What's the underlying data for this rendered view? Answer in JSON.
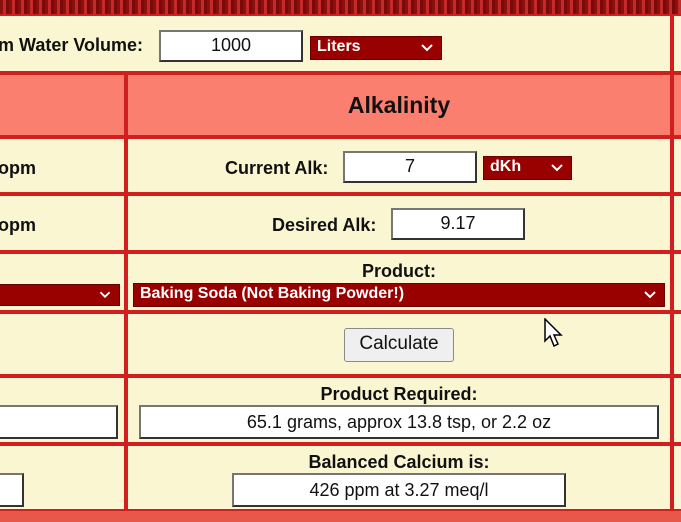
{
  "volume": {
    "label": "m Water Volume:",
    "value": "1000",
    "unit": "Liters"
  },
  "alkalinity": {
    "title": "Alkalinity",
    "current_label": "Current Alk:",
    "current_value": "7",
    "current_unit": "dKh",
    "desired_label": "Desired Alk:",
    "desired_value": "9.17",
    "product_label": "Product:",
    "product_value": "Baking Soda (Not Baking Powder!)",
    "calculate_label": "Calculate",
    "required_label": "Product Required:",
    "required_value": "65.1 grams, approx 13.8 tsp, or  2.2 oz",
    "balanced_label": "Balanced Calcium is:",
    "balanced_value": "426 ppm at 3.27 meq/l"
  },
  "left_column": {
    "row1_text": "opm",
    "row2_text": "opm"
  },
  "colors": {
    "page_red": "#b01414",
    "cell_bg": "#fbf6d2",
    "header_bg": "#fb7f6e",
    "select_bg": "#990000"
  }
}
